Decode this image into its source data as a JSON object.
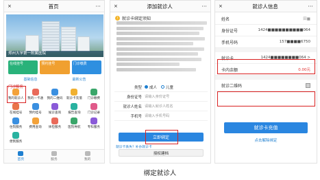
{
  "panel1": {
    "title": "首页",
    "close": "×",
    "more": "···",
    "hero_caption": "郑州大学第一附属医院",
    "quick_buttons": [
      {
        "label": "在线挂号"
      },
      {
        "label": "预约挂号"
      },
      {
        "label": "门诊缴费"
      }
    ],
    "nav_links": [
      "基础信息",
      "最新公告"
    ],
    "section_label": "门诊服务",
    "grid_items": [
      {
        "label": "我的就诊人",
        "color": "#f3a23a"
      },
      {
        "label": "我的一卡通",
        "color": "#e96a5a"
      },
      {
        "label": "我的二维码",
        "color": "#3a8fe0"
      },
      {
        "label": "就诊卡充值",
        "color": "#f0b030"
      },
      {
        "label": "门诊缴费",
        "color": "#3aa66a"
      },
      {
        "label": "在线挂号",
        "color": "#e9744a"
      },
      {
        "label": "预约挂号",
        "color": "#3a8fe0"
      },
      {
        "label": "候诊查询",
        "color": "#8a5ad8"
      },
      {
        "label": "报告查询",
        "color": "#29b2a0"
      },
      {
        "label": "门诊记录",
        "color": "#e05a8a"
      },
      {
        "label": "住院服务",
        "color": "#3a8fe0"
      },
      {
        "label": "费用查询",
        "color": "#f3a23a"
      },
      {
        "label": "体检服务",
        "color": "#e96a5a"
      },
      {
        "label": "医院导航",
        "color": "#3aa66a"
      },
      {
        "label": "专科服务",
        "color": "#8a5ad8"
      },
      {
        "label": "便民服务",
        "color": "#29b2a0"
      }
    ],
    "tabs": [
      {
        "label": "首页"
      },
      {
        "label": "服务"
      },
      {
        "label": "我的"
      }
    ]
  },
  "panel2": {
    "title": "添加就诊人",
    "close": "×",
    "more": "···",
    "notice_title": "就诊卡绑定须知",
    "notice_line_count_note": "",
    "form": {
      "type_label": "类型",
      "type_options": [
        "成人",
        "儿童"
      ],
      "id_label": "身份证号",
      "id_placeholder": "请输入身份证号",
      "name_label": "就诊人姓名",
      "name_placeholder": "请输入就诊人姓名",
      "phone_label": "手机号",
      "phone_placeholder": "请输入手机号码"
    },
    "bind_button": "立即绑定",
    "lost_link": "就诊卡丢失？补办就诊卡",
    "auth_button": "授权建档"
  },
  "panel3": {
    "title": "就诊人信息",
    "close": "×",
    "more": "···",
    "rows": [
      {
        "key": "姓名",
        "value": "田■"
      },
      {
        "key": "身份证号",
        "value": "1424■■■■■■■■■■064"
      },
      {
        "key": "手机号码",
        "value": "157■■■■6750"
      },
      {
        "key": "就诊卡",
        "value": "1424■■■■■■■■064 >"
      },
      {
        "key": "卡内余额",
        "value": "0.00元"
      },
      {
        "key": "就诊二维码",
        "value": ""
      }
    ],
    "recharge_button": "就诊卡充值",
    "unbind_link": "点击解除绑定"
  },
  "caption": "绑定就诊人"
}
